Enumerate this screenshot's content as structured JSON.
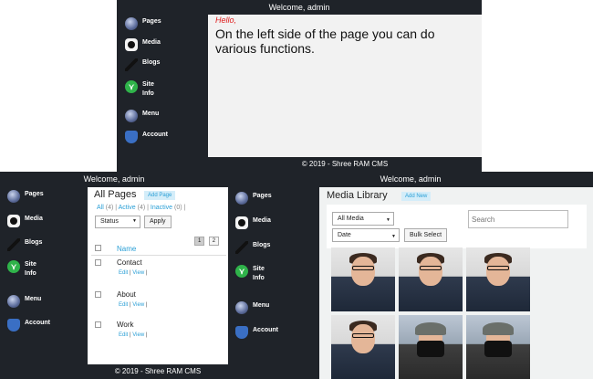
{
  "welcome": "Welcome, admin",
  "sidebar": {
    "items": [
      {
        "label": "Pages",
        "icon": "bubble-icon"
      },
      {
        "label": "Media",
        "icon": "camera-icon"
      },
      {
        "label": "Blogs",
        "icon": "pen-icon"
      },
      {
        "label": "Site Info",
        "icon": "site-info-icon"
      },
      {
        "label": "Menu",
        "icon": "bubble-icon"
      },
      {
        "label": "Account",
        "icon": "shield-icon"
      }
    ]
  },
  "home": {
    "greeting": "Hello,",
    "message": "On the left side of the page you can do various functions."
  },
  "footer": "© 2019 - Shree RAM CMS",
  "pages": {
    "title": "All Pages",
    "add_label": "Add Page",
    "filter_all": "All",
    "count_all": "(4)",
    "filter_active": "Active",
    "count_active": "(4)",
    "filter_inactive": "Inactive",
    "count_inactive": "(0)",
    "status_select": "Status",
    "apply_label": "Apply",
    "page1": "1",
    "page2": "2",
    "col_name": "Name",
    "rows": [
      {
        "name": "Contact"
      },
      {
        "name": "About"
      },
      {
        "name": "Work"
      }
    ],
    "edit_label": "Edit",
    "view_label": "View"
  },
  "media": {
    "title": "Media Library",
    "add_label": "Add New",
    "filter_select": "All Media",
    "date_select": "Date",
    "bulk_label": "Bulk Select",
    "search_placeholder": "Search",
    "thumbs": [
      "portrait-photo",
      "portrait-photo",
      "portrait-photo",
      "portrait-photo",
      "camera-photo",
      "camera-photo"
    ]
  }
}
